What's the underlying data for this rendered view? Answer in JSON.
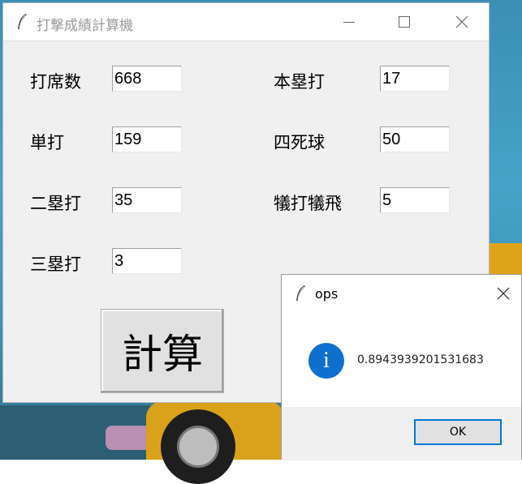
{
  "main_window": {
    "title": "打撃成績計算機",
    "fields": {
      "at_bats": {
        "label": "打席数",
        "value": "668"
      },
      "single": {
        "label": "単打",
        "value": "159"
      },
      "double": {
        "label": "二塁打",
        "value": "35"
      },
      "triple": {
        "label": "三塁打",
        "value": "3"
      },
      "home_run": {
        "label": "本塁打",
        "value": "17"
      },
      "walks": {
        "label": "四死球",
        "value": "50"
      },
      "sacrifice": {
        "label": "犠打犠飛",
        "value": "5"
      }
    },
    "calc_button": "計算"
  },
  "dialog": {
    "title": "ops",
    "message": "0.8943939201531683",
    "ok_button": "OK"
  },
  "icons": {
    "app": "feather-icon",
    "minimize": "minimize-icon",
    "maximize": "maximize-icon",
    "close": "close-icon",
    "info": "info-icon"
  },
  "colors": {
    "info_blue": "#0f6fcf",
    "ok_border": "#0078d7"
  }
}
